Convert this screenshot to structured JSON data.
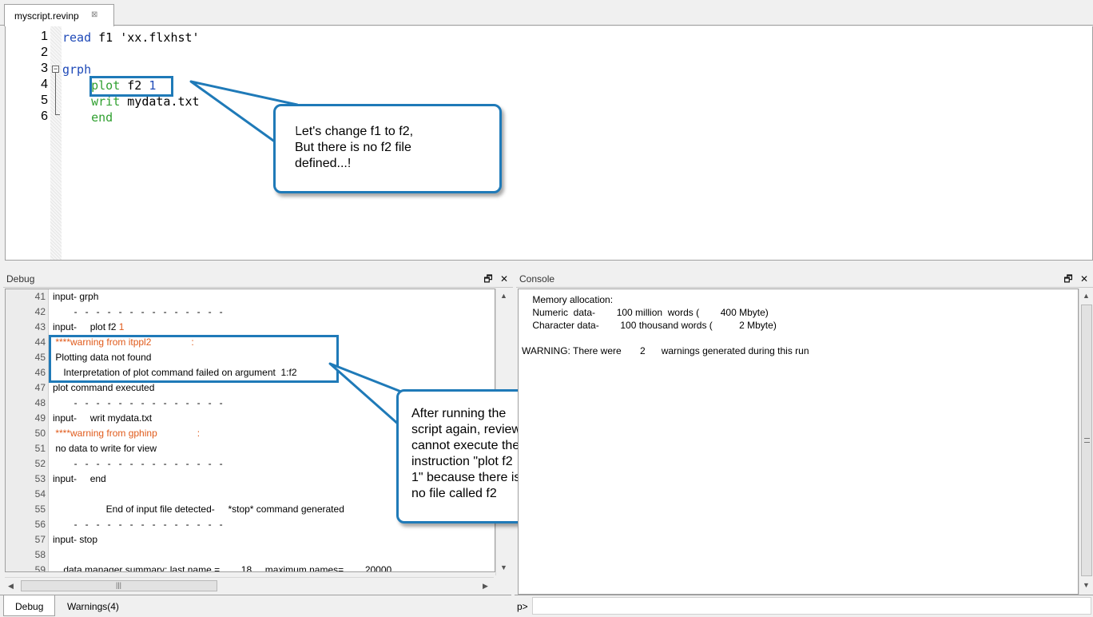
{
  "editor": {
    "tab_label": "myscript.revinp",
    "tab_close": "⊠",
    "fold_marker": "−",
    "line_numbers": [
      "1",
      "2",
      "3",
      "4",
      "5",
      "6"
    ],
    "lines": [
      {
        "parts": [
          {
            "t": "read",
            "c": "blue"
          },
          {
            "t": " f1 'xx.flxhst'",
            "c": ""
          }
        ]
      },
      {
        "parts": []
      },
      {
        "parts": [
          {
            "t": "grph",
            "c": "blue"
          }
        ]
      },
      {
        "parts": [
          {
            "t": "    ",
            "c": ""
          },
          {
            "t": "plot",
            "c": "green"
          },
          {
            "t": " f2 ",
            "c": ""
          },
          {
            "t": "1",
            "c": "blue"
          }
        ]
      },
      {
        "parts": [
          {
            "t": "    ",
            "c": ""
          },
          {
            "t": "writ",
            "c": "green"
          },
          {
            "t": " mydata.txt",
            "c": ""
          }
        ]
      },
      {
        "parts": [
          {
            "t": "    ",
            "c": ""
          },
          {
            "t": "end",
            "c": "green"
          }
        ]
      }
    ]
  },
  "callouts": {
    "editor_note": [
      "Let's change f1 to f2,",
      "But there is no f2 file",
      "defined...!"
    ],
    "debug_note": [
      "After running the",
      "script again, review",
      "cannot execute the",
      "instruction \"plot f2",
      "1\" because there is",
      "no file called f2"
    ]
  },
  "debug": {
    "title": "Debug",
    "lines": [
      {
        "no": "41",
        "text": "input- grph",
        "warn": false
      },
      {
        "no": "42",
        "text": "        -   -   -   -   -   -   -   -   -   -   -   -   -   -",
        "warn": false
      },
      {
        "no": "43",
        "text": "input-     plot f2 ",
        "warn": false,
        "suffix": "1"
      },
      {
        "no": "44",
        "text": " ****warning from itppl2               :",
        "warn": true
      },
      {
        "no": "45",
        "text": " Plotting data not found",
        "warn": false
      },
      {
        "no": "46",
        "text": "    Interpretation of plot command failed on argument  1:f2",
        "warn": false
      },
      {
        "no": "47",
        "text": "plot command executed",
        "warn": false
      },
      {
        "no": "48",
        "text": "        -   -   -   -   -   -   -   -   -   -   -   -   -   -",
        "warn": false
      },
      {
        "no": "49",
        "text": "input-     writ mydata.txt",
        "warn": false
      },
      {
        "no": "50",
        "text": " ****warning from gphinp               :",
        "warn": true
      },
      {
        "no": "51",
        "text": " no data to write for view",
        "warn": false
      },
      {
        "no": "52",
        "text": "        -   -   -   -   -   -   -   -   -   -   -   -   -   -",
        "warn": false
      },
      {
        "no": "53",
        "text": "input-     end",
        "warn": false
      },
      {
        "no": "54",
        "text": "",
        "warn": false
      },
      {
        "no": "55",
        "text": "                    End of input file detected-     *stop* command generated",
        "warn": false
      },
      {
        "no": "56",
        "text": "        -   -   -   -   -   -   -   -   -   -   -   -   -   -",
        "warn": false
      },
      {
        "no": "57",
        "text": "input- stop",
        "warn": false
      },
      {
        "no": "58",
        "text": "",
        "warn": false
      },
      {
        "no": "59",
        "text": "    data manager summary: last name =        18     maximum names=        20000",
        "warn": false
      }
    ]
  },
  "bottom_tabs": [
    {
      "label": "Debug",
      "active": true
    },
    {
      "label": "Warnings(4)",
      "active": false
    }
  ],
  "console": {
    "title": "Console",
    "lines": [
      "    Memory allocation:",
      "    Numeric  data-        100 million  words (        400 Mbyte)",
      "    Character data-        100 thousand words (          2 Mbyte)",
      "",
      "WARNING: There were       2      warnings generated during this run"
    ],
    "prompt_label": "p>",
    "prompt_value": ""
  },
  "colors": {
    "accent": "#1f7ab8",
    "keyword_blue": "#1f4ab8",
    "keyword_green": "#30a030",
    "warning": "#e05a1a"
  },
  "icons": {
    "restore": "🗗",
    "close": "✕",
    "scroll_up": "▲",
    "scroll_down": "▼",
    "scroll_left": "◀",
    "scroll_right": "▶",
    "grip": "|||"
  }
}
